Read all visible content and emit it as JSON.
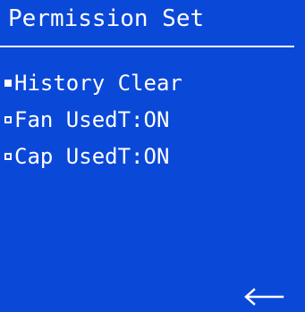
{
  "screen": {
    "title": "Permission  Set",
    "background_color": "#0a48d8",
    "foreground_color": "#ffffff"
  },
  "menu": {
    "items": [
      {
        "label": "History Clear",
        "selected": true
      },
      {
        "label": "Fan UsedT:ON",
        "selected": false
      },
      {
        "label": "Cap UsedT:ON",
        "selected": false
      }
    ]
  },
  "navigation": {
    "back_icon": "left-arrow-icon"
  }
}
